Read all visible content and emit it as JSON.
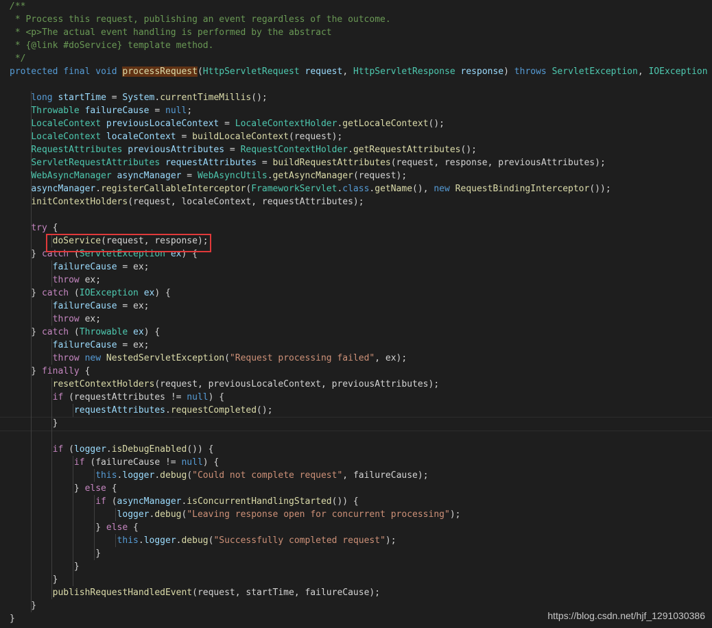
{
  "watermark": "https://blog.csdn.net/hjf_1291030386",
  "colors": {
    "background": "#1e1e1e",
    "keyword": "#569cd6",
    "control": "#c586c0",
    "type": "#4ec9b0",
    "function": "#dcdcaa",
    "variable": "#9cdcfe",
    "string": "#ce9178",
    "comment": "#6a9955",
    "plain": "#d4d4d4",
    "highlight_box": "#e0393a"
  },
  "code": {
    "highlighted_statement": "doService(request, response);",
    "lines": [
      [
        [
          "cmi",
          "/**"
        ]
      ],
      [
        [
          "cm",
          " * Process this request, publishing an event regardless of the outcome."
        ]
      ],
      [
        [
          "cm",
          " * <p>The actual event handling is performed by the abstract"
        ]
      ],
      [
        [
          "cm",
          " * {@link #doService} template method."
        ]
      ],
      [
        [
          "cm",
          " */"
        ]
      ],
      [
        [
          "kw",
          "protected"
        ],
        [
          "pl",
          " "
        ],
        [
          "kw",
          "final"
        ],
        [
          "pl",
          " "
        ],
        [
          "kw",
          "void"
        ],
        [
          "pl",
          " "
        ],
        [
          "fn hl",
          "processRequest"
        ],
        [
          "pl",
          "("
        ],
        [
          "ty",
          "HttpServletRequest"
        ],
        [
          "pl",
          " "
        ],
        [
          "var",
          "request"
        ],
        [
          "pl",
          ", "
        ],
        [
          "ty",
          "HttpServletResponse"
        ],
        [
          "pl",
          " "
        ],
        [
          "var",
          "response"
        ],
        [
          "pl",
          ") "
        ],
        [
          "kw",
          "throws"
        ],
        [
          "pl",
          " "
        ],
        [
          "ty",
          "ServletException"
        ],
        [
          "pl",
          ", "
        ],
        [
          "ty",
          "IOException"
        ],
        [
          "pl",
          " {"
        ]
      ],
      [],
      [
        [
          "pl",
          "    "
        ],
        [
          "kw",
          "long"
        ],
        [
          "pl",
          " "
        ],
        [
          "var",
          "startTime"
        ],
        [
          "pl",
          " = "
        ],
        [
          "var",
          "System"
        ],
        [
          "pl",
          "."
        ],
        [
          "fn",
          "currentTimeMillis"
        ],
        [
          "pl",
          "();"
        ]
      ],
      [
        [
          "pl",
          "    "
        ],
        [
          "ty",
          "Throwable"
        ],
        [
          "pl",
          " "
        ],
        [
          "var",
          "failureCause"
        ],
        [
          "pl",
          " = "
        ],
        [
          "kw",
          "null"
        ],
        [
          "pl",
          ";"
        ]
      ],
      [
        [
          "pl",
          "    "
        ],
        [
          "ty",
          "LocaleContext"
        ],
        [
          "pl",
          " "
        ],
        [
          "var",
          "previousLocaleContext"
        ],
        [
          "pl",
          " = "
        ],
        [
          "ty",
          "LocaleContextHolder"
        ],
        [
          "pl",
          "."
        ],
        [
          "fn",
          "getLocaleContext"
        ],
        [
          "pl",
          "();"
        ]
      ],
      [
        [
          "pl",
          "    "
        ],
        [
          "ty",
          "LocaleContext"
        ],
        [
          "pl",
          " "
        ],
        [
          "var",
          "localeContext"
        ],
        [
          "pl",
          " = "
        ],
        [
          "fn",
          "buildLocaleContext"
        ],
        [
          "pl",
          "(request);"
        ]
      ],
      [
        [
          "pl",
          "    "
        ],
        [
          "ty",
          "RequestAttributes"
        ],
        [
          "pl",
          " "
        ],
        [
          "var",
          "previousAttributes"
        ],
        [
          "pl",
          " = "
        ],
        [
          "ty",
          "RequestContextHolder"
        ],
        [
          "pl",
          "."
        ],
        [
          "fn",
          "getRequestAttributes"
        ],
        [
          "pl",
          "();"
        ]
      ],
      [
        [
          "pl",
          "    "
        ],
        [
          "ty",
          "ServletRequestAttributes"
        ],
        [
          "pl",
          " "
        ],
        [
          "var",
          "requestAttributes"
        ],
        [
          "pl",
          " = "
        ],
        [
          "fn",
          "buildRequestAttributes"
        ],
        [
          "pl",
          "(request, response, previousAttributes);"
        ]
      ],
      [
        [
          "pl",
          "    "
        ],
        [
          "ty",
          "WebAsyncManager"
        ],
        [
          "pl",
          " "
        ],
        [
          "var",
          "asyncManager"
        ],
        [
          "pl",
          " = "
        ],
        [
          "ty",
          "WebAsyncUtils"
        ],
        [
          "pl",
          "."
        ],
        [
          "fn",
          "getAsyncManager"
        ],
        [
          "pl",
          "(request);"
        ]
      ],
      [
        [
          "pl",
          "    "
        ],
        [
          "var",
          "asyncManager"
        ],
        [
          "pl",
          "."
        ],
        [
          "fn",
          "registerCallableInterceptor"
        ],
        [
          "pl",
          "("
        ],
        [
          "ty",
          "FrameworkServlet"
        ],
        [
          "pl",
          "."
        ],
        [
          "kw",
          "class"
        ],
        [
          "pl",
          "."
        ],
        [
          "fn",
          "getName"
        ],
        [
          "pl",
          "(), "
        ],
        [
          "kw",
          "new"
        ],
        [
          "pl",
          " "
        ],
        [
          "fn",
          "RequestBindingInterceptor"
        ],
        [
          "pl",
          "());"
        ]
      ],
      [
        [
          "pl",
          "    "
        ],
        [
          "fn",
          "initContextHolders"
        ],
        [
          "pl",
          "(request, localeContext, requestAttributes);"
        ]
      ],
      [],
      [
        [
          "pl",
          "    "
        ],
        [
          "ctl",
          "try"
        ],
        [
          "pl",
          " {"
        ]
      ],
      [
        [
          "pl",
          "        "
        ],
        [
          "fn",
          "doService"
        ],
        [
          "pl",
          "(request, response);"
        ]
      ],
      [
        [
          "pl",
          "    } "
        ],
        [
          "ctl",
          "catch"
        ],
        [
          "pl",
          " ("
        ],
        [
          "ty",
          "ServletException"
        ],
        [
          "pl",
          " "
        ],
        [
          "var",
          "ex"
        ],
        [
          "pl",
          ") {"
        ]
      ],
      [
        [
          "pl",
          "        "
        ],
        [
          "var",
          "failureCause"
        ],
        [
          "pl",
          " = ex;"
        ]
      ],
      [
        [
          "pl",
          "        "
        ],
        [
          "ctl",
          "throw"
        ],
        [
          "pl",
          " ex;"
        ]
      ],
      [
        [
          "pl",
          "    } "
        ],
        [
          "ctl",
          "catch"
        ],
        [
          "pl",
          " ("
        ],
        [
          "ty",
          "IOException"
        ],
        [
          "pl",
          " "
        ],
        [
          "var",
          "ex"
        ],
        [
          "pl",
          ") {"
        ]
      ],
      [
        [
          "pl",
          "        "
        ],
        [
          "var",
          "failureCause"
        ],
        [
          "pl",
          " = ex;"
        ]
      ],
      [
        [
          "pl",
          "        "
        ],
        [
          "ctl",
          "throw"
        ],
        [
          "pl",
          " ex;"
        ]
      ],
      [
        [
          "pl",
          "    } "
        ],
        [
          "ctl",
          "catch"
        ],
        [
          "pl",
          " ("
        ],
        [
          "ty",
          "Throwable"
        ],
        [
          "pl",
          " "
        ],
        [
          "var",
          "ex"
        ],
        [
          "pl",
          ") {"
        ]
      ],
      [
        [
          "pl",
          "        "
        ],
        [
          "var",
          "failureCause"
        ],
        [
          "pl",
          " = ex;"
        ]
      ],
      [
        [
          "pl",
          "        "
        ],
        [
          "ctl",
          "throw"
        ],
        [
          "pl",
          " "
        ],
        [
          "kw",
          "new"
        ],
        [
          "pl",
          " "
        ],
        [
          "fn",
          "NestedServletException"
        ],
        [
          "pl",
          "("
        ],
        [
          "str",
          "\"Request processing failed\""
        ],
        [
          "pl",
          ", ex);"
        ]
      ],
      [
        [
          "pl",
          "    } "
        ],
        [
          "ctl",
          "finally"
        ],
        [
          "pl",
          " {"
        ]
      ],
      [
        [
          "pl",
          "        "
        ],
        [
          "fn",
          "resetContextHolders"
        ],
        [
          "pl",
          "(request, previousLocaleContext, previousAttributes);"
        ]
      ],
      [
        [
          "pl",
          "        "
        ],
        [
          "ctl",
          "if"
        ],
        [
          "pl",
          " (requestAttributes != "
        ],
        [
          "kw",
          "null"
        ],
        [
          "pl",
          ") {"
        ]
      ],
      [
        [
          "pl",
          "            "
        ],
        [
          "var",
          "requestAttributes"
        ],
        [
          "pl",
          "."
        ],
        [
          "fn",
          "requestCompleted"
        ],
        [
          "pl",
          "();"
        ]
      ],
      [
        [
          "pl",
          "        }"
        ]
      ],
      [],
      [
        [
          "pl",
          "        "
        ],
        [
          "ctl",
          "if"
        ],
        [
          "pl",
          " ("
        ],
        [
          "var",
          "logger"
        ],
        [
          "pl",
          "."
        ],
        [
          "fn",
          "isDebugEnabled"
        ],
        [
          "pl",
          "()) {"
        ]
      ],
      [
        [
          "pl",
          "            "
        ],
        [
          "ctl",
          "if"
        ],
        [
          "pl",
          " (failureCause != "
        ],
        [
          "kw",
          "null"
        ],
        [
          "pl",
          ") {"
        ]
      ],
      [
        [
          "pl",
          "                "
        ],
        [
          "kw",
          "this"
        ],
        [
          "pl",
          "."
        ],
        [
          "var",
          "logger"
        ],
        [
          "pl",
          "."
        ],
        [
          "fn",
          "debug"
        ],
        [
          "pl",
          "("
        ],
        [
          "str",
          "\"Could not complete request\""
        ],
        [
          "pl",
          ", failureCause);"
        ]
      ],
      [
        [
          "pl",
          "            } "
        ],
        [
          "ctl",
          "else"
        ],
        [
          "pl",
          " {"
        ]
      ],
      [
        [
          "pl",
          "                "
        ],
        [
          "ctl",
          "if"
        ],
        [
          "pl",
          " ("
        ],
        [
          "var",
          "asyncManager"
        ],
        [
          "pl",
          "."
        ],
        [
          "fn",
          "isConcurrentHandlingStarted"
        ],
        [
          "pl",
          "()) {"
        ]
      ],
      [
        [
          "pl",
          "                    "
        ],
        [
          "var",
          "logger"
        ],
        [
          "pl",
          "."
        ],
        [
          "fn",
          "debug"
        ],
        [
          "pl",
          "("
        ],
        [
          "str",
          "\"Leaving response open for concurrent processing\""
        ],
        [
          "pl",
          ");"
        ]
      ],
      [
        [
          "pl",
          "                } "
        ],
        [
          "ctl",
          "else"
        ],
        [
          "pl",
          " {"
        ]
      ],
      [
        [
          "pl",
          "                    "
        ],
        [
          "kw",
          "this"
        ],
        [
          "pl",
          "."
        ],
        [
          "var",
          "logger"
        ],
        [
          "pl",
          "."
        ],
        [
          "fn",
          "debug"
        ],
        [
          "pl",
          "("
        ],
        [
          "str",
          "\"Successfully completed request\""
        ],
        [
          "pl",
          ");"
        ]
      ],
      [
        [
          "pl",
          "                }"
        ]
      ],
      [
        [
          "pl",
          "            }"
        ]
      ],
      [
        [
          "pl",
          "        }"
        ]
      ],
      [
        [
          "pl",
          "        "
        ],
        [
          "fn",
          "publishRequestHandledEvent"
        ],
        [
          "pl",
          "(request, startTime, failureCause);"
        ]
      ],
      [
        [
          "pl",
          "    }"
        ]
      ],
      [
        [
          "pl",
          "}"
        ]
      ]
    ]
  }
}
